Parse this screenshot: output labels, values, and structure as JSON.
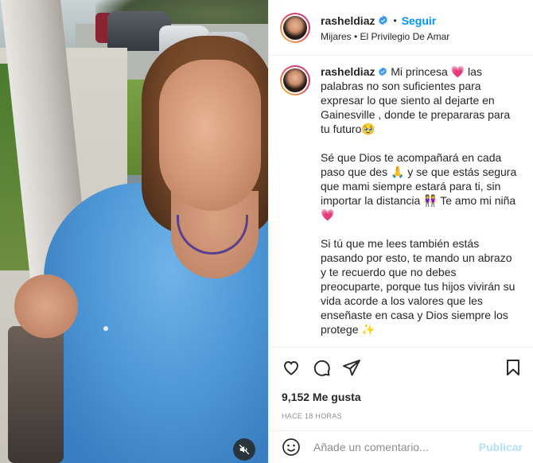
{
  "header": {
    "username": "rasheldiaz",
    "separator": "•",
    "follow_label": "Seguir",
    "location": "Mijares • El Privilegio De Amar"
  },
  "caption": {
    "username": "rasheldiaz",
    "paragraphs": [
      "Mi princesa 💗  las palabras no son suficientes para expresar lo que siento al dejarte en Gainesville , donde te prepararas para tu futuro🥹",
      "Sé que Dios te acompañará en cada paso que des 🙏  y se que estás segura que mami siempre estará para ti, sin importar la distancia 👭 Te amo mi niña 💗",
      "Si tú que me lees también estás pasando por esto, te mando un abrazo y te recuerdo que no debes preocuparte, porque tus hijos vivirán su vida acorde a los valores que les enseñaste en casa y Dios siempre los protege ✨"
    ]
  },
  "stats": {
    "likes": "9,152 Me gusta",
    "time": "HACE 18 HORAS"
  },
  "comment": {
    "placeholder": "Añade un comentario...",
    "publish_label": "Publicar"
  },
  "icons": {
    "verified": "verified-badge-icon",
    "like": "heart-icon",
    "comment": "comment-bubble-icon",
    "share": "paper-plane-icon",
    "save": "bookmark-icon",
    "emoji": "smiley-icon",
    "mute": "speaker-muted-icon"
  },
  "colors": {
    "accent": "#0095f6",
    "verified": "#3897f0",
    "publish_disabled": "#b2dffc",
    "muted_text": "#8e8e8e",
    "text": "#262626"
  }
}
